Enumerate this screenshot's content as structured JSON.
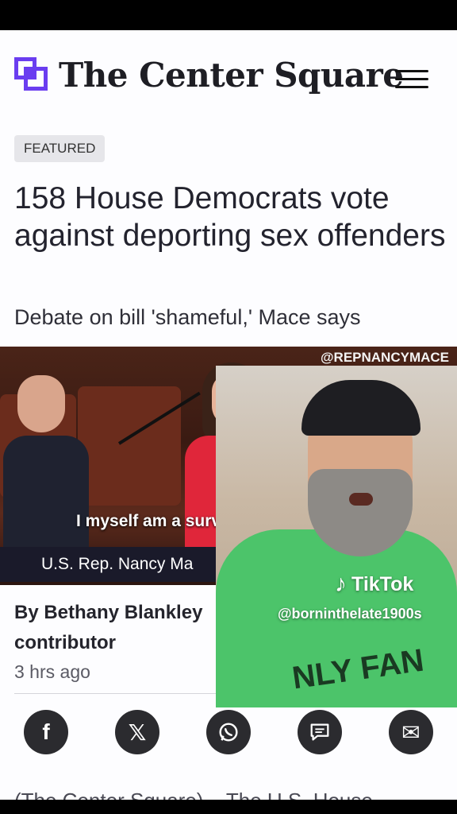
{
  "site": {
    "name": "The Center Square"
  },
  "article": {
    "badge": "FEATURED",
    "headline": "158 House Democrats vote against deporting sex offenders",
    "subhead": "Debate on bill 'shameful,' Mace says",
    "byline": "By Bethany Blankley contributor",
    "time": "3 hrs ago",
    "teaser": "(The Center Square) – The U.S. House"
  },
  "video": {
    "handle": "@REPNANCYMACE",
    "caption": "I myself am a survivor of",
    "chyron": "U.S. Rep. Nancy Ma"
  },
  "overlay": {
    "brand": "TikTok",
    "user": "@borninthelate1900s",
    "shirt_text": "NLY FAN"
  },
  "share": [
    {
      "name": "facebook",
      "icon": "facebook-icon",
      "glyph": "f"
    },
    {
      "name": "x",
      "icon": "x-icon",
      "glyph": "𝕏"
    },
    {
      "name": "whatsapp",
      "icon": "whatsapp-icon",
      "glyph": ""
    },
    {
      "name": "comment",
      "icon": "comment-icon",
      "glyph": ""
    },
    {
      "name": "email",
      "icon": "email-icon",
      "glyph": "✉"
    }
  ],
  "colors": {
    "brand": "#6a3df0",
    "share_bg": "#2b2b2f",
    "dress": "#e0263a",
    "shirt": "#4cc46a"
  }
}
